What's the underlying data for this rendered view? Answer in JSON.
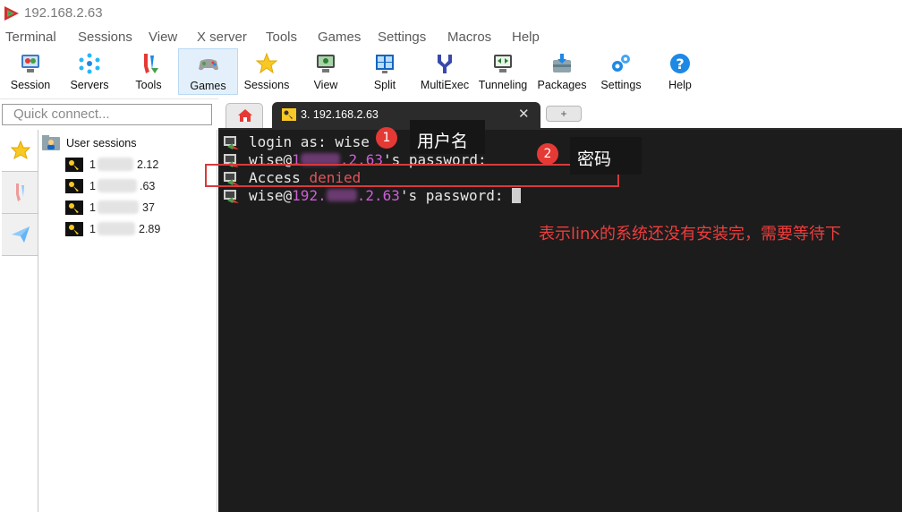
{
  "window": {
    "title": "192.168.2.63"
  },
  "menu": [
    "Terminal",
    "Sessions",
    "View",
    "X server",
    "Tools",
    "Games",
    "Settings",
    "Macros",
    "Help"
  ],
  "toolbar": [
    {
      "label": "Session",
      "icon": "session-icon"
    },
    {
      "label": "Servers",
      "icon": "servers-icon"
    },
    {
      "label": "Tools",
      "icon": "tools-icon"
    },
    {
      "label": "Games",
      "icon": "games-icon",
      "active": true
    },
    {
      "label": "Sessions",
      "icon": "sessions-star-icon"
    },
    {
      "label": "View",
      "icon": "view-icon"
    },
    {
      "label": "Split",
      "icon": "split-icon"
    },
    {
      "label": "MultiExec",
      "icon": "multiexec-icon"
    },
    {
      "label": "Tunneling",
      "icon": "tunneling-icon"
    },
    {
      "label": "Packages",
      "icon": "packages-icon"
    },
    {
      "label": "Settings",
      "icon": "settings-icon"
    },
    {
      "label": "Help",
      "icon": "help-icon"
    }
  ],
  "sidebar": {
    "quick_connect_placeholder": "Quick connect...",
    "root_label": "User sessions",
    "sessions": [
      {
        "prefix": "1",
        "suffix": "2.12"
      },
      {
        "prefix": "1",
        "suffix": ".63"
      },
      {
        "prefix": "1",
        "suffix": "37"
      },
      {
        "prefix": "1",
        "suffix": "2.89"
      }
    ]
  },
  "tabs": {
    "session_tab_label": "3. 192.168.2.63",
    "close_glyph": "✕",
    "new_tab_glyph": "+"
  },
  "terminal": {
    "line1": "login as: wise",
    "line2_user": "wise@",
    "line2_ip_a": "1",
    "line2_ip_b": ".2.63",
    "line2_rest": "'s password:",
    "line3_a": "Access ",
    "line3_b": "denied",
    "line4_user": "wise@",
    "line4_ip_a": "192.",
    "line4_ip_b": ".2.63",
    "line4_rest": "'s password: "
  },
  "annotations": {
    "badge1": "1",
    "callout1": "用户名",
    "badge2": "2",
    "callout2": "密码",
    "note": "表示linx的系统还没有安装完，需要等待下"
  },
  "colors": {
    "terminal_bg": "#1c1c1c",
    "ip_color": "#cc5fd6",
    "error_color": "#e0555a",
    "annotation_red": "#e53935"
  }
}
